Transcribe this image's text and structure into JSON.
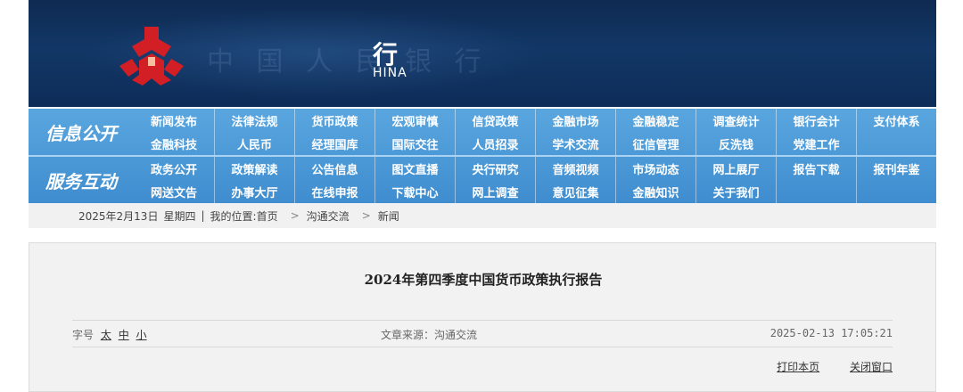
{
  "banner": {
    "title_cn": "行",
    "title_en": "HINA",
    "faded_text": "中 国 人 民 银 行"
  },
  "nav": {
    "section1_label": "信息公开",
    "section2_label": "服务互动",
    "row1": [
      "新闻发布",
      "法律法规",
      "货币政策",
      "宏观审慎",
      "信贷政策",
      "金融市场",
      "金融稳定",
      "调查统计",
      "银行会计",
      "支付体系"
    ],
    "row2": [
      "金融科技",
      "人民币",
      "经理国库",
      "国际交往",
      "人员招录",
      "学术交流",
      "征信管理",
      "反洗钱",
      "党建工作",
      ""
    ],
    "row3": [
      "政务公开",
      "政策解读",
      "公告信息",
      "图文直播",
      "央行研究",
      "音频视频",
      "市场动态",
      "网上展厅",
      "报告下载",
      "报刊年鉴"
    ],
    "row4": [
      "网送文告",
      "办事大厅",
      "在线申报",
      "下载中心",
      "网上调查",
      "意见征集",
      "金融知识",
      "关于我们",
      "",
      ""
    ]
  },
  "breadcrumb": {
    "date": "2025年2月13日",
    "weekday": "星期四",
    "divider": "|",
    "location_label": "我的位置:",
    "home": "首页",
    "sep": ">",
    "level1": "沟通交流",
    "level2": "新闻"
  },
  "article": {
    "title": "2024年第四季度中国货币政策执行报告",
    "font_size_label": "字号",
    "size_large": "太",
    "size_medium": "中",
    "size_small": "小",
    "source": "文章来源：沟通交流",
    "datetime": "2025-02-13 17:05:21",
    "print_label": "打印本页",
    "close_label": "关闭窗口"
  },
  "colors": {
    "banner_bg": "#123766",
    "nav_bg": "#4a98d6",
    "logo_red": "#d21f26"
  }
}
